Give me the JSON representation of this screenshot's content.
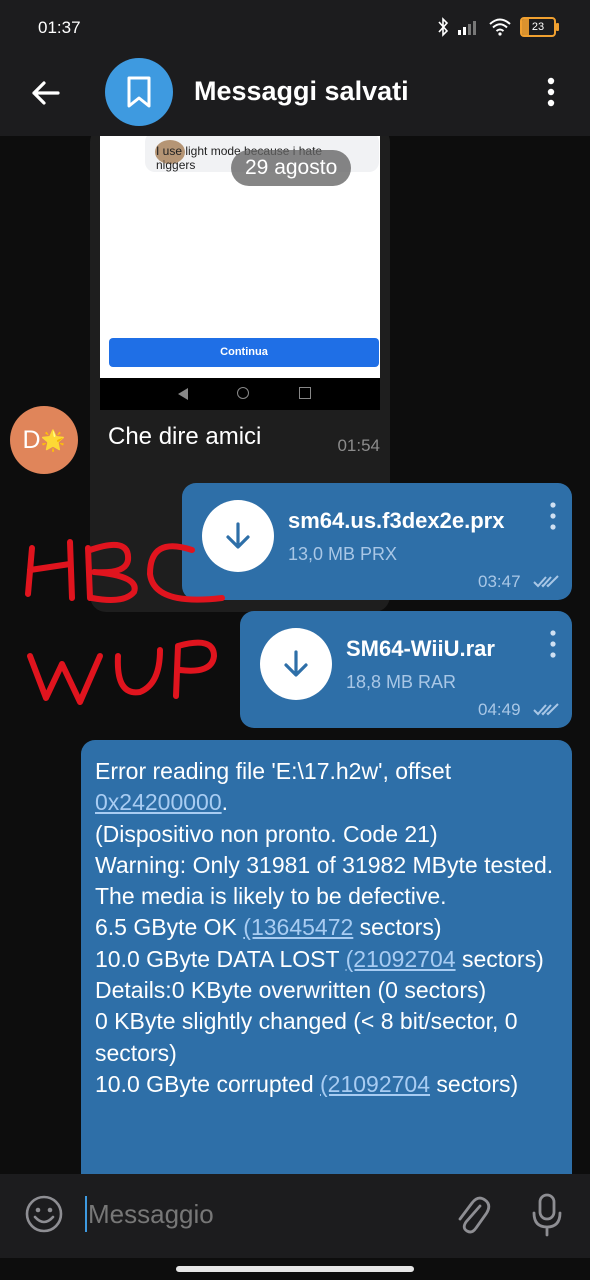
{
  "status_bar": {
    "time": "01:37",
    "battery": "23"
  },
  "header": {
    "title": "Messaggi salvati"
  },
  "screenshot_message": {
    "comment_text": "I use light mode because i hate niggers",
    "button_label": "Continua",
    "date_chip": "29 agosto",
    "caption": "Che dire amici",
    "time": "01:54",
    "sender_initial": "D",
    "sender_badge": "🌟"
  },
  "file_messages": [
    {
      "name": "sm64.us.f3dex2e.prx",
      "meta": "13,0 MB PRX",
      "time": "03:47"
    },
    {
      "name": "SM64-WiiU.rar",
      "meta": "18,8 MB RAR",
      "time": "04:49"
    }
  ],
  "text_message": {
    "line1_pre": "Error reading file 'E:\\17.h2w', offset",
    "line1_link": "0x24200000",
    "line1_post": ".",
    "line2": "(Dispositivo non pronto. Code 21)",
    "line3": "Warning: Only 31981 of 31982 MByte tested.",
    "line4": "The media is likely to be defective.",
    "line5_pre": "6.5 GByte OK ",
    "line5_link": "(13645472",
    "line5_post": " sectors)",
    "line6_pre": "10.0 GByte DATA LOST ",
    "line6_link": "(21092704",
    "line6_post": " sectors)",
    "line7": "Details:0 KByte overwritten (0 sectors)",
    "line8": "0 KByte slightly changed (< 8 bit/sector, 0 sectors)",
    "line9_pre": "10.0 GByte corrupted ",
    "line9_link": "(21092704",
    "line9_post": " sectors)"
  },
  "input": {
    "placeholder": "Messaggio"
  },
  "icons": {
    "back": "arrow-left-icon",
    "saved": "bookmark-icon",
    "menu": "more-vertical-icon",
    "download": "download-arrow-icon",
    "emoji": "emoji-icon",
    "attach": "paperclip-icon",
    "mic": "microphone-icon"
  },
  "colors": {
    "accent": "#3e9ae0",
    "outgoing_bubble": "#2e6fa8",
    "background": "#0d0d0d",
    "bar": "#1c1c1e",
    "scribble": "#e0141e"
  }
}
